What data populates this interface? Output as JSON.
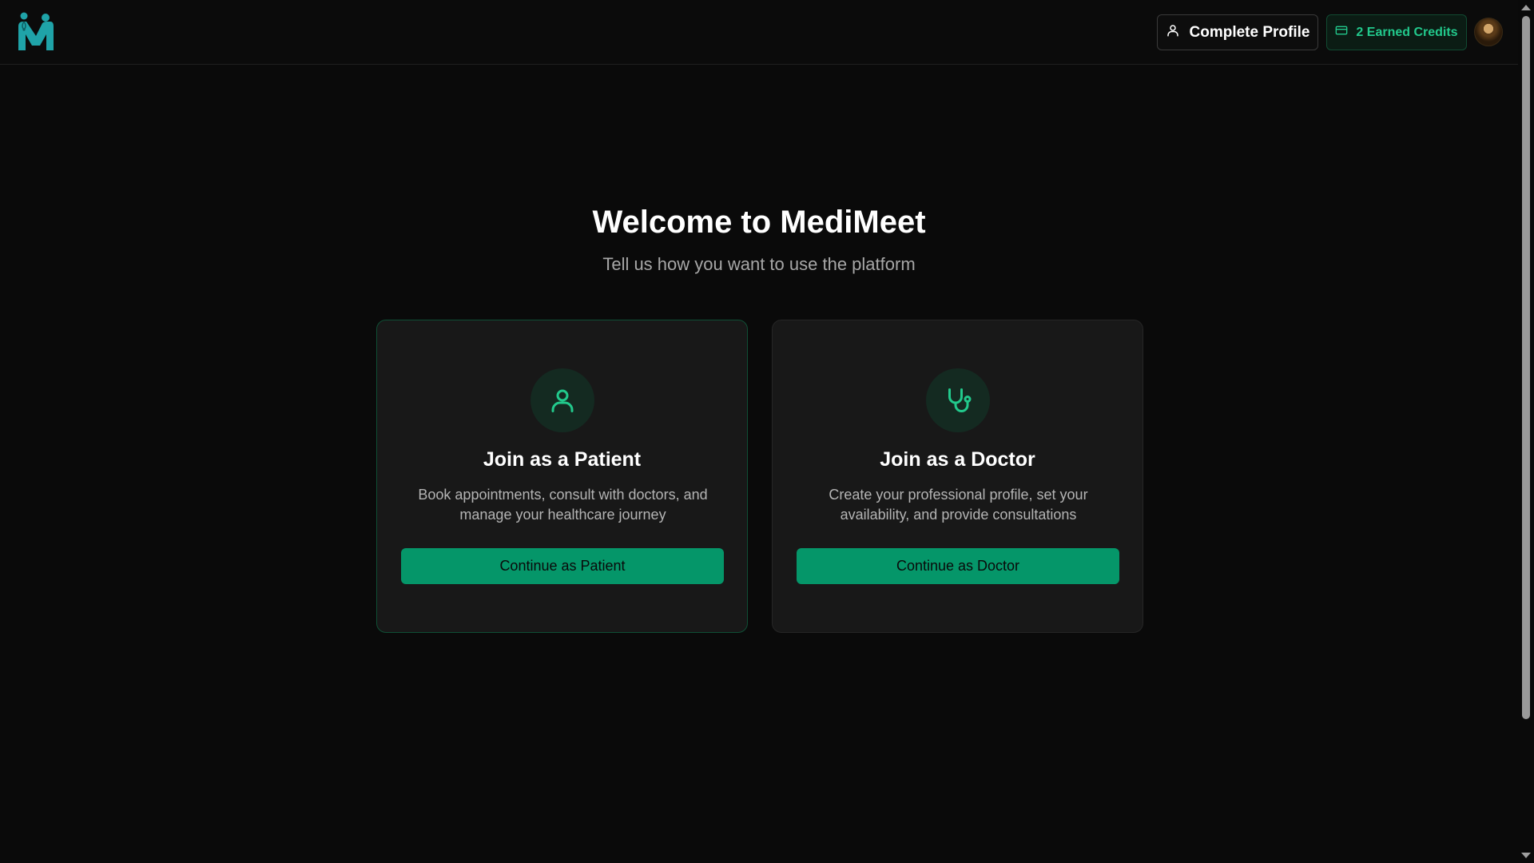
{
  "header": {
    "logo_icon": "medimeet-logo-icon",
    "complete_profile_label": "Complete Profile",
    "complete_profile_icon": "user-icon",
    "credits_label": "2 Earned Credits",
    "credits_icon": "credit-card-icon",
    "avatar_icon": "user-avatar"
  },
  "main": {
    "title": "Welcome to MediMeet",
    "subtitle": "Tell us how you want to use the platform"
  },
  "cards": [
    {
      "icon": "user-icon",
      "title": "Join as a Patient",
      "description": "Book appointments, consult with doctors, and manage your healthcare journey",
      "button_label": "Continue as Patient"
    },
    {
      "icon": "stethoscope-icon",
      "title": "Join as a Doctor",
      "description": "Create your professional profile, set your availability, and provide consultations",
      "button_label": "Continue as Doctor"
    }
  ],
  "colors": {
    "background": "#0a0a0a",
    "accent": "#059669",
    "accent_text": "#22c98c",
    "card": "#181818"
  }
}
